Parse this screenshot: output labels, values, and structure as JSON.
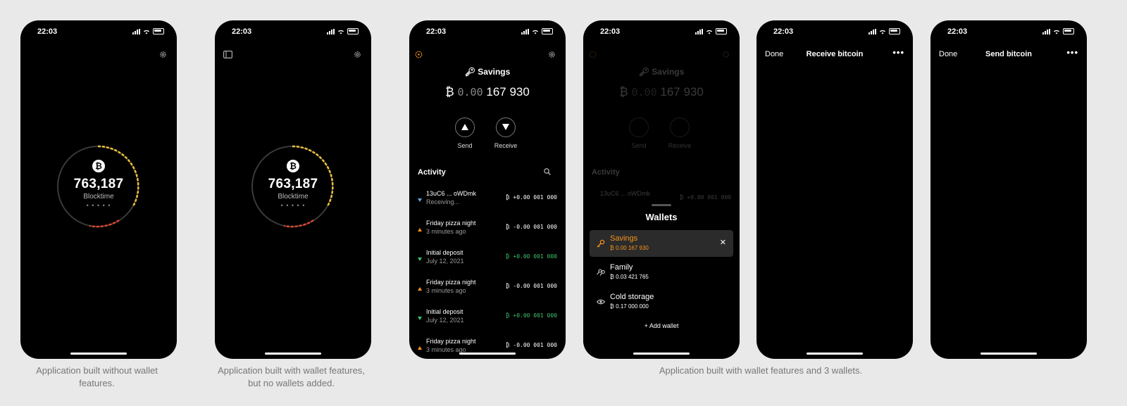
{
  "status": {
    "time": "22:03"
  },
  "blocktime": {
    "number": "763,187",
    "label": "Blocktime",
    "dots": "• • • • •",
    "btc_symbol": "₿"
  },
  "wallet": {
    "name": "Savings",
    "balance_symbol": "₿",
    "balance_dim": "0.00",
    "balance_main": "167 930",
    "send_label": "Send",
    "receive_label": "Receive",
    "activity_label": "Activity",
    "transactions": [
      {
        "name": "13uC6 ... oWDmk",
        "sub": "Receiving...",
        "amount": "₿ +0.00 001 000",
        "direction": "in",
        "color": "#5aa9e6"
      },
      {
        "name": "Friday pizza night",
        "sub": "3 minutes ago",
        "amount": "₿ -0.00 001 000",
        "direction": "out",
        "color": "#f7931a"
      },
      {
        "name": "Initial deposit",
        "sub": "July 12, 2021",
        "amount": "₿ +0.00 001 000",
        "direction": "in",
        "color": "#3cc36a"
      },
      {
        "name": "Friday pizza night",
        "sub": "3 minutes ago",
        "amount": "₿ -0.00 001 000",
        "direction": "out",
        "color": "#f7931a"
      },
      {
        "name": "Initial deposit",
        "sub": "July 12, 2021",
        "amount": "₿ +0.00 001 000",
        "direction": "in",
        "color": "#3cc36a"
      },
      {
        "name": "Friday pizza night",
        "sub": "3 minutes ago",
        "amount": "₿ -0.00 001 000",
        "direction": "out",
        "color": "#f7931a"
      }
    ]
  },
  "wallets_sheet": {
    "title": "Wallets",
    "items": [
      {
        "name": "Savings",
        "balance": "₿ 0.00 167 930",
        "icon": "key-icon",
        "selected": true
      },
      {
        "name": "Family",
        "balance": "₿ 0.03 421 765",
        "icon": "multisig-key-icon",
        "selected": false
      },
      {
        "name": "Cold storage",
        "balance": "₿ 0.17 000 000",
        "icon": "eye-icon",
        "selected": false
      }
    ],
    "add_label": "+ Add wallet",
    "close_glyph": "✕"
  },
  "receive": {
    "done": "Done",
    "title": "Receive bitcoin",
    "more": "•••"
  },
  "send": {
    "done": "Done",
    "title": "Send bitcoin",
    "more": "•••"
  },
  "captions": {
    "one": "Application built without wallet features.",
    "two": "Application built with wallet features, but no wallets added.",
    "three": "Application built with wallet features and 3 wallets."
  },
  "colors": {
    "accent": "#f7931a",
    "incoming": "#3cc36a",
    "pending": "#5aa9e6",
    "ring_yellow": "#f2c23a",
    "ring_red": "#e2462e"
  }
}
